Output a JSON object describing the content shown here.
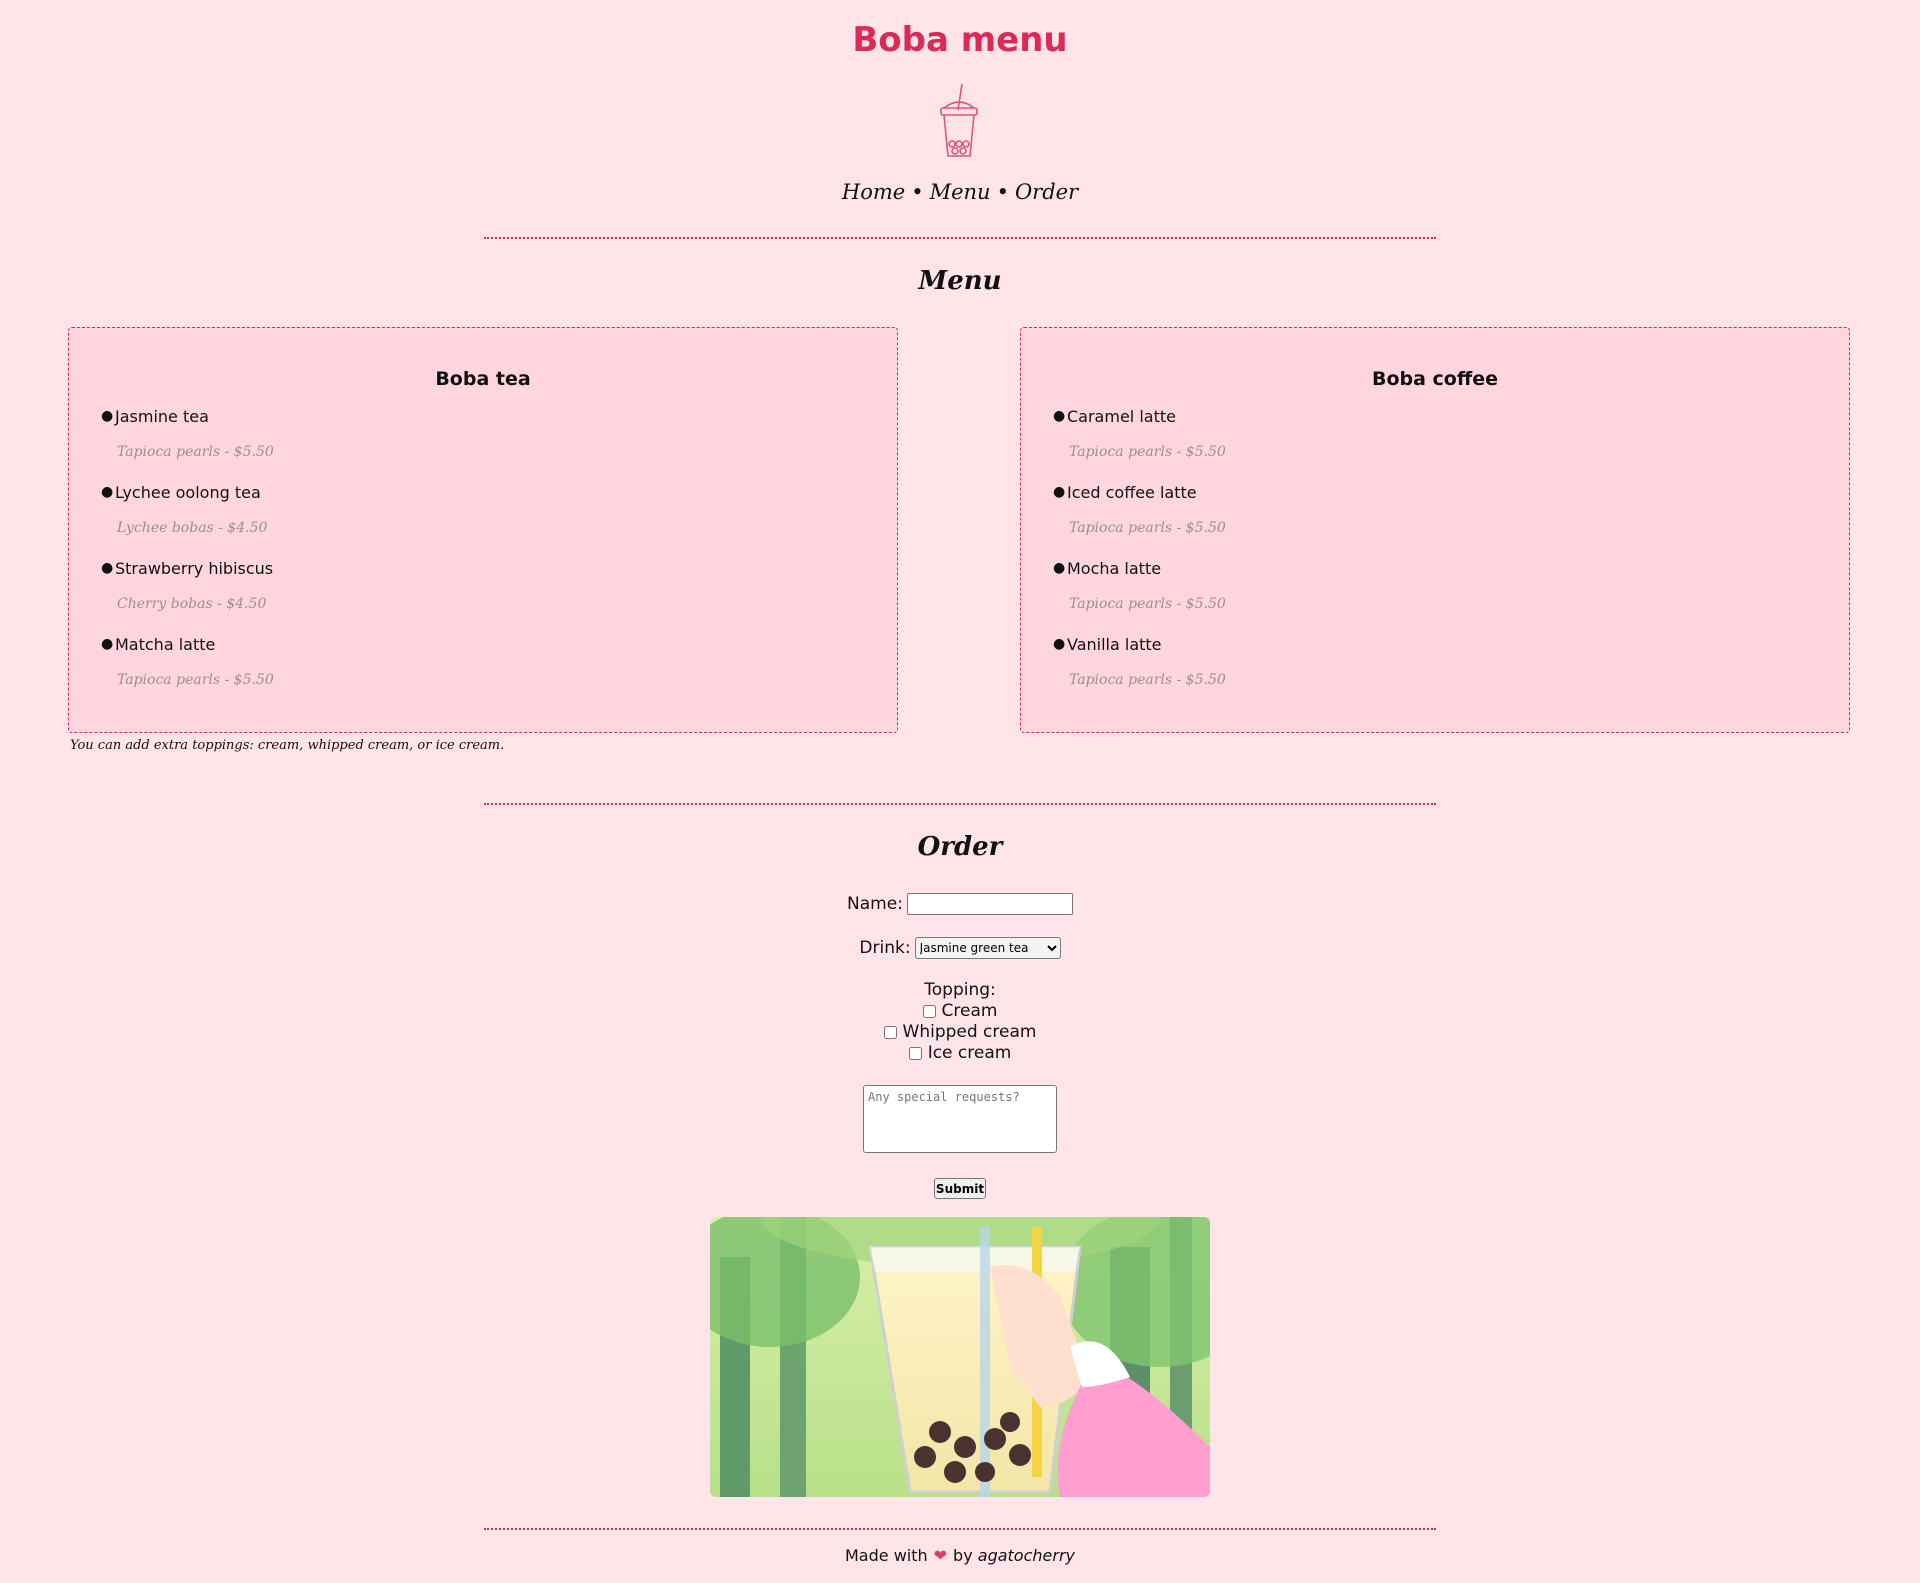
{
  "header": {
    "title": "Boba menu",
    "logo_icon": "boba-cup-icon",
    "nav": [
      {
        "label": "Home"
      },
      {
        "label": "Menu"
      },
      {
        "label": "Order"
      }
    ],
    "nav_separator": "•"
  },
  "menu": {
    "title": "Menu",
    "tea": {
      "heading": "Boba tea",
      "items": [
        {
          "name": "Jasmine tea",
          "detail": "Tapioca pearls - $5.50"
        },
        {
          "name": "Lychee oolong tea",
          "detail": "Lychee bobas - $4.50"
        },
        {
          "name": "Strawberry hibiscus",
          "detail": "Cherry bobas - $4.50"
        },
        {
          "name": "Matcha latte",
          "detail": "Tapioca pearls - $5.50"
        }
      ]
    },
    "coffee": {
      "heading": "Boba coffee",
      "items": [
        {
          "name": "Caramel latte",
          "detail": "Tapioca pearls - $5.50"
        },
        {
          "name": "Iced coffee latte",
          "detail": "Tapioca pearls - $5.50"
        },
        {
          "name": "Mocha latte",
          "detail": "Tapioca pearls - $5.50"
        },
        {
          "name": "Vanilla latte",
          "detail": "Tapioca pearls - $5.50"
        }
      ]
    },
    "note": "You can add extra toppings: cream, whipped cream, or ice cream."
  },
  "order": {
    "title": "Order",
    "name_label": "Name:",
    "name_value": "",
    "drink_label": "Drink:",
    "drink_selected": "Jasmine green tea",
    "topping_label": "Topping:",
    "toppings": [
      {
        "label": "Cream",
        "checked": false
      },
      {
        "label": "Whipped cream",
        "checked": false
      },
      {
        "label": "Ice cream",
        "checked": false
      }
    ],
    "requests_placeholder": "Any special requests?",
    "submit_label": "Submit"
  },
  "footer": {
    "made_with": "Made with",
    "heart": "❤",
    "by": "by",
    "author": "agatocherry"
  },
  "colors": {
    "background": "#ffe4e9",
    "accent": "#dc2a57",
    "card": "#ffd6df"
  }
}
